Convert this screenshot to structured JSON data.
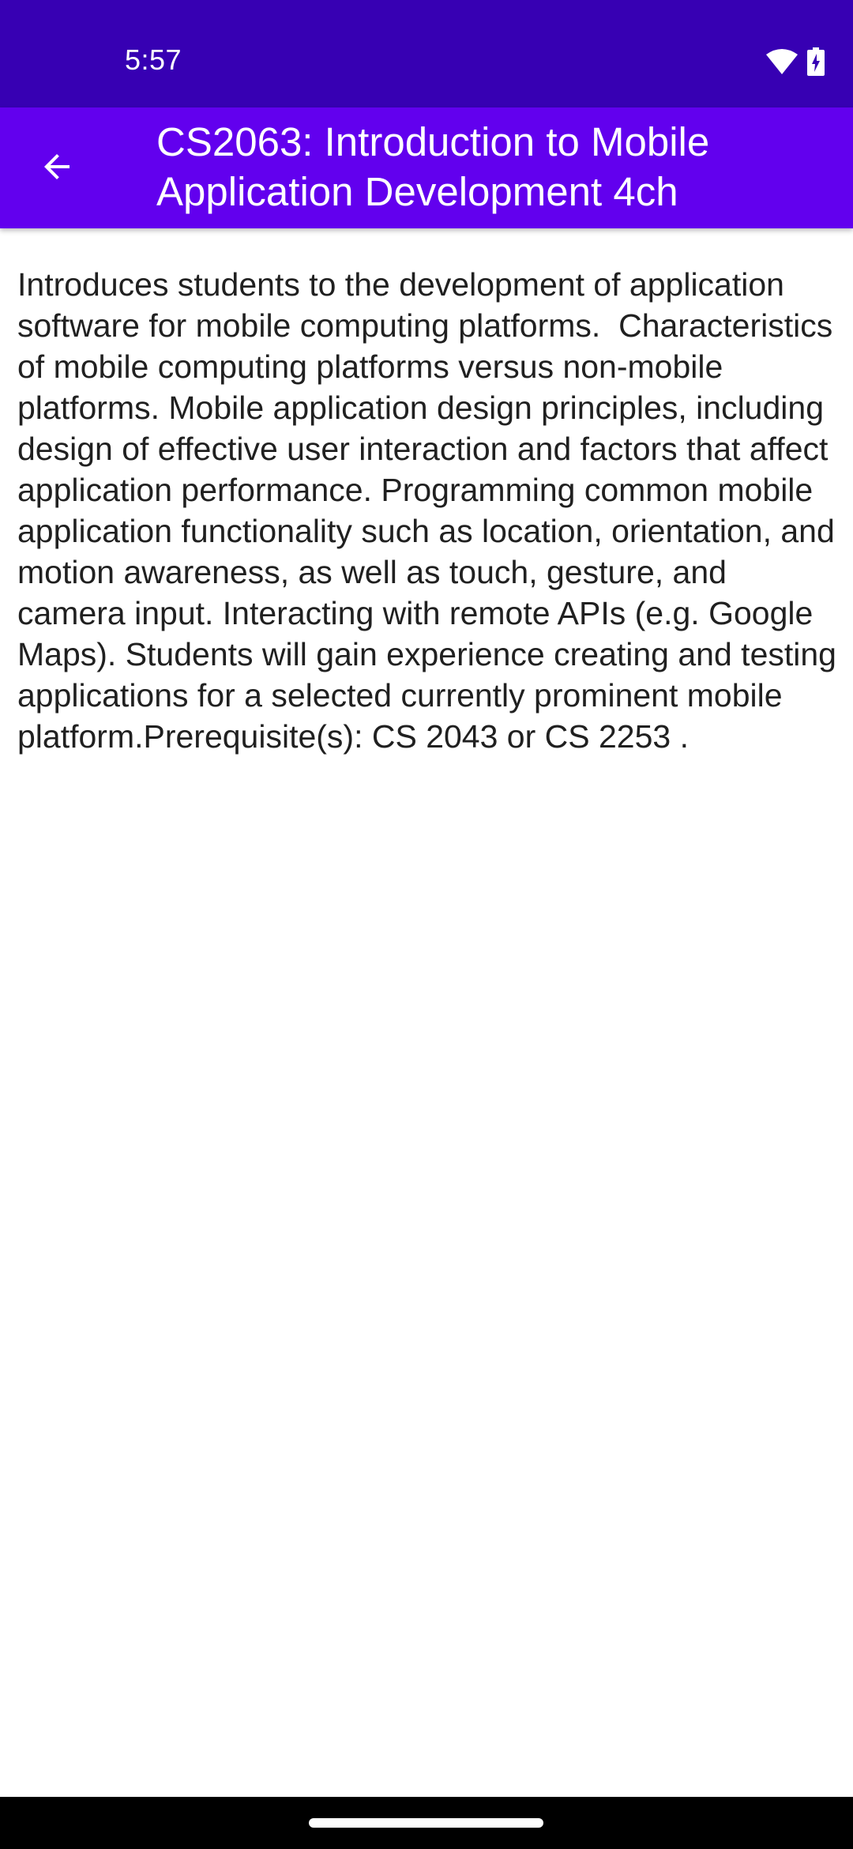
{
  "status_bar": {
    "time": "5:57",
    "background": "#3700b3",
    "icons": [
      "wifi-icon",
      "battery-charging-icon"
    ]
  },
  "app_bar": {
    "title": "CS2063: Introduction to Mobile Application Development 4ch",
    "background": "#6200ee",
    "back_icon": "arrow-left-icon"
  },
  "content": {
    "description": "Introduces students to the development of application software for mobile computing platforms.  Characteristics of mobile computing platforms versus non-mobile platforms. Mobile application design principles, including design of effective user interaction and factors that affect application performance. Programming common mobile application functionality such as location, orientation, and motion awareness, as well as touch, gesture, and camera input. Interacting with remote APIs (e.g. Google Maps). Students will gain experience creating and testing applications for a selected currently prominent mobile platform.Prerequisite(s): CS 2043 or CS 2253 ."
  },
  "nav_bar": {
    "background": "#000000",
    "home_handle": "home-handle"
  }
}
